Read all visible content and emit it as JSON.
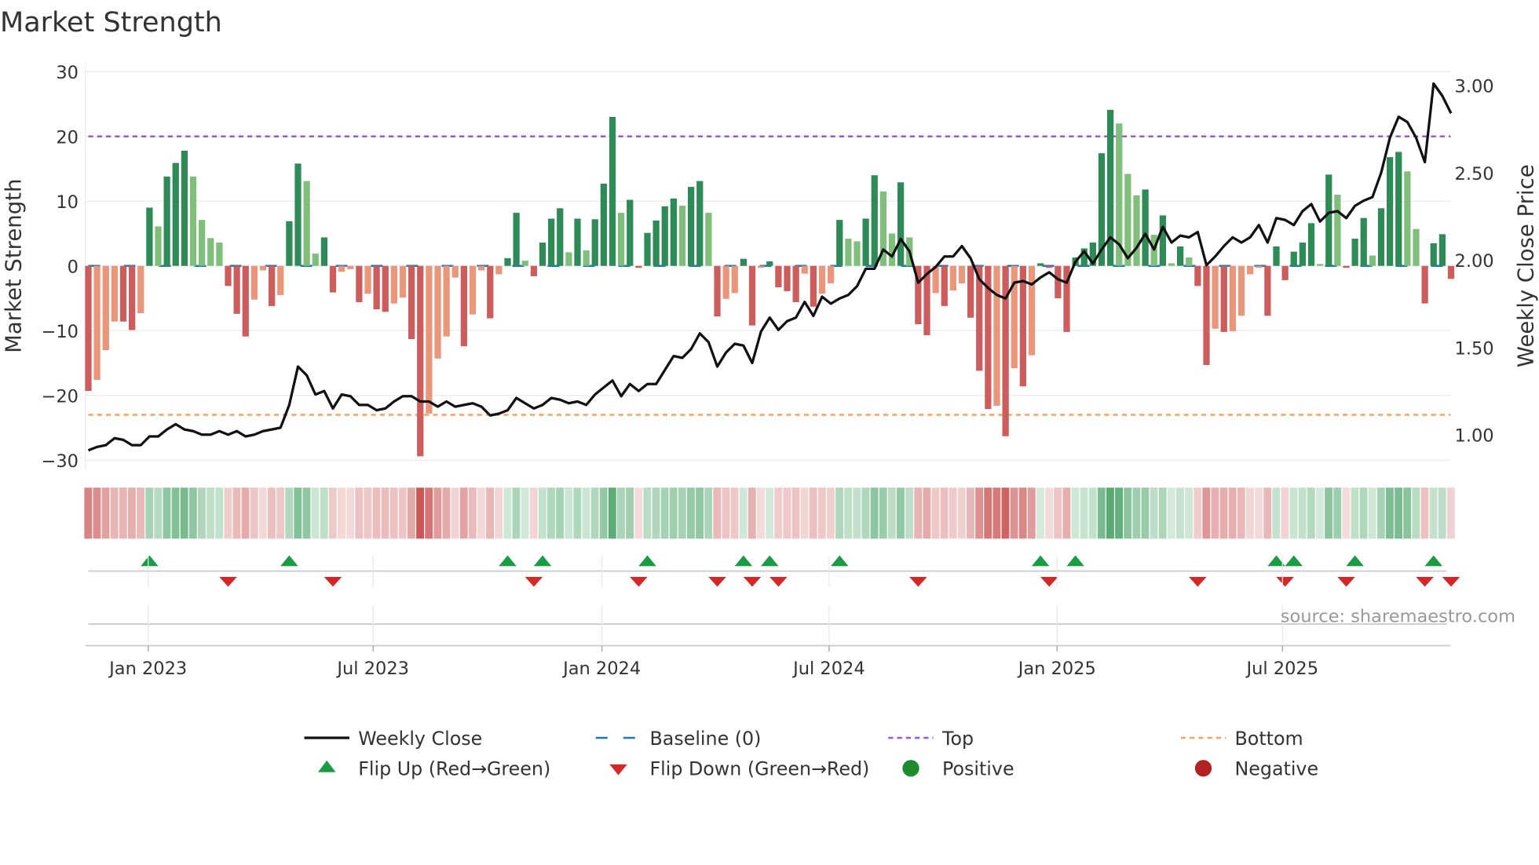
{
  "chart_data": {
    "type": "bar",
    "title": "Market Strength",
    "ylabel": "Market Strength",
    "y2label": "Weekly Close Price",
    "ylim": [
      -31,
      31
    ],
    "y2lim": [
      0.85,
      3.1
    ],
    "yticks": [
      30,
      20,
      10,
      0,
      -10,
      -20,
      -30
    ],
    "yticklabels": [
      "30",
      "20",
      "10",
      "0",
      "−10",
      "−20",
      "−30"
    ],
    "y2ticks": [
      3.0,
      2.5,
      2.0,
      1.5,
      1.0
    ],
    "y2ticklabels": [
      "3.00",
      "2.50",
      "2.00",
      "1.50",
      "1.00"
    ],
    "x_unit": "week index",
    "xticks": [
      {
        "pos": 6.85,
        "label": "Jan 2023"
      },
      {
        "pos": 32.6,
        "label": "Jul 2023"
      },
      {
        "pos": 58.8,
        "label": "Jan 2024"
      },
      {
        "pos": 84.8,
        "label": "Jul 2024"
      },
      {
        "pos": 110.9,
        "label": "Jan 2025"
      },
      {
        "pos": 136.7,
        "label": "Jul 2025"
      }
    ],
    "reference_lines": {
      "top": 20,
      "bottom": -23,
      "baseline": 0
    },
    "strength": [
      -19.3,
      -17.6,
      -13,
      -8.6,
      -8.6,
      -9.9,
      -7.3,
      9.0,
      6.1,
      13.8,
      15.9,
      17.8,
      13.8,
      7.1,
      4.3,
      3.6,
      -3.1,
      -7.4,
      -10.9,
      -5.2,
      -0.7,
      -6.2,
      -4.5,
      6.9,
      15.8,
      13.1,
      1.9,
      4.4,
      -4.1,
      -0.9,
      -0.5,
      -5.6,
      -4.3,
      -6.7,
      -7.1,
      -5.8,
      -4.9,
      -11.3,
      -29.4,
      -22.8,
      -14.3,
      -10.9,
      -1.8,
      -12.4,
      -7.5,
      -0.7,
      -8.1,
      -1.3,
      1.2,
      8.2,
      0.8,
      -1.6,
      3.6,
      7.3,
      8.9,
      2.1,
      7.3,
      2.4,
      7.2,
      12.7,
      23.0,
      8.2,
      10.2,
      -0.3,
      5.1,
      7.0,
      9.2,
      10.4,
      9.3,
      12.2,
      13.1,
      8.2,
      -7.8,
      -5.1,
      -4.2,
      1.1,
      -9.2,
      -0.3,
      0.7,
      -3.3,
      -3.9,
      -5.6,
      -1.2,
      -6.3,
      -4.3,
      -2.7,
      7.1,
      4.2,
      3.8,
      7.3,
      14.0,
      11.5,
      5.0,
      12.9,
      4.4,
      -9.0,
      -10.7,
      -4.2,
      -6.2,
      -3.8,
      -2.7,
      -8.0,
      -16.2,
      -22.1,
      -21.6,
      -26.3,
      -15.8,
      -18.6,
      -13.8,
      0.4,
      -0.3,
      -5.0,
      -10.2,
      1.3,
      2.7,
      3.6,
      17.4,
      24.1,
      22.0,
      14.2,
      10.9,
      11.8,
      4.8,
      7.8,
      0.4,
      3.0,
      1.3,
      -3.1,
      -15.3,
      -9.7,
      -10.2,
      -10.1,
      -7.7,
      -1.3,
      -0.3,
      -7.7,
      3.0,
      -2.2,
      2.2,
      3.6,
      6.6,
      0.3,
      14.1,
      11.0,
      -0.3,
      4.2,
      7.4,
      1.6,
      8.9,
      16.8,
      17.6,
      14.6,
      5.7,
      -5.8,
      3.5,
      4.9,
      -2.0
    ],
    "weekly_close": [
      0.91,
      0.93,
      0.94,
      0.98,
      0.97,
      0.94,
      0.94,
      0.99,
      0.99,
      1.03,
      1.06,
      1.03,
      1.02,
      1.0,
      1.0,
      1.02,
      1.0,
      1.02,
      0.99,
      1.0,
      1.02,
      1.03,
      1.04,
      1.17,
      1.39,
      1.34,
      1.23,
      1.25,
      1.15,
      1.23,
      1.22,
      1.17,
      1.17,
      1.14,
      1.15,
      1.19,
      1.22,
      1.22,
      1.19,
      1.19,
      1.16,
      1.19,
      1.16,
      1.17,
      1.18,
      1.16,
      1.11,
      1.12,
      1.14,
      1.21,
      1.18,
      1.15,
      1.17,
      1.21,
      1.2,
      1.18,
      1.19,
      1.17,
      1.23,
      1.27,
      1.31,
      1.22,
      1.29,
      1.25,
      1.29,
      1.29,
      1.37,
      1.45,
      1.44,
      1.49,
      1.58,
      1.53,
      1.39,
      1.47,
      1.52,
      1.51,
      1.41,
      1.59,
      1.67,
      1.6,
      1.65,
      1.67,
      1.76,
      1.68,
      1.79,
      1.75,
      1.78,
      1.8,
      1.85,
      1.95,
      1.95,
      2.06,
      2.02,
      2.12,
      2.05,
      1.87,
      1.92,
      1.96,
      2.02,
      2.02,
      2.08,
      2.01,
      1.89,
      1.84,
      1.8,
      1.78,
      1.87,
      1.88,
      1.86,
      1.9,
      1.93,
      1.89,
      1.87,
      1.99,
      2.05,
      1.98,
      2.06,
      2.13,
      2.09,
      2.01,
      2.07,
      2.15,
      2.06,
      2.19,
      2.1,
      2.14,
      2.13,
      2.16,
      1.97,
      2.02,
      2.08,
      2.13,
      2.1,
      2.13,
      2.2,
      2.1,
      2.24,
      2.23,
      2.2,
      2.28,
      2.32,
      2.22,
      2.27,
      2.28,
      2.24,
      2.31,
      2.34,
      2.36,
      2.5,
      2.7,
      2.82,
      2.79,
      2.7,
      2.56,
      3.01,
      2.94,
      2.84
    ],
    "legend": [
      {
        "label": "Weekly Close",
        "symbol": "line"
      },
      {
        "label": "Baseline (0)",
        "symbol": "dash"
      },
      {
        "label": "Top",
        "symbol": "dot-purple"
      },
      {
        "label": "Bottom",
        "symbol": "dot-orange"
      },
      {
        "label": "Flip Up (Red→Green)",
        "symbol": "triangle-up"
      },
      {
        "label": "Flip Down (Green→Red)",
        "symbol": "triangle-down"
      },
      {
        "label": "Positive",
        "symbol": "circle-green"
      },
      {
        "label": "Negative",
        "symbol": "circle-red"
      }
    ],
    "legend_placement": "bottom",
    "source": "source: sharemaestro.com"
  },
  "colors": {
    "pos_strong": "#2e8b57",
    "pos_weak": "#7fbf7b",
    "neg_strong": "#cd5c5c",
    "neg_weak": "#e9967a",
    "top": "#9b59d6",
    "bottom": "#f4a261",
    "baseline": "#1f77b4",
    "flip_up": "#1a9c45",
    "flip_down": "#d62728",
    "positive": "#1e8c2e",
    "negative": "#b22222",
    "price": "#111111"
  }
}
